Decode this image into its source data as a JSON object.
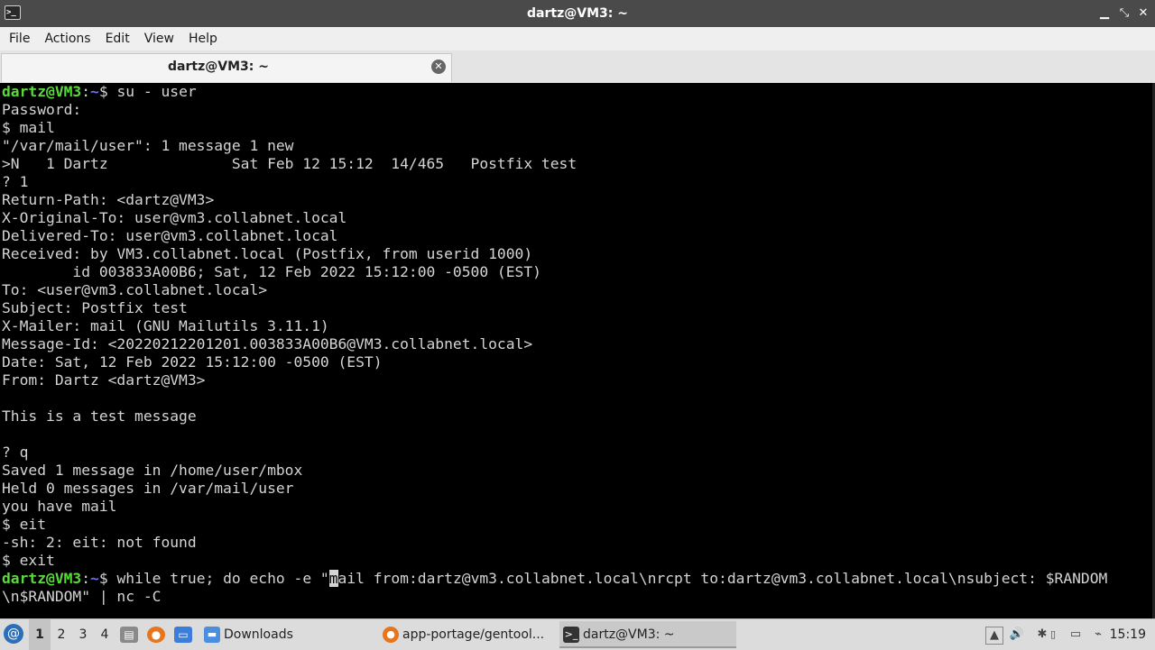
{
  "window": {
    "title": "dartz@VM3: ~",
    "controls": {
      "minimize": "▁",
      "maximize": "⤡",
      "close": "✕"
    }
  },
  "menu": {
    "items": [
      "File",
      "Actions",
      "Edit",
      "View",
      "Help"
    ]
  },
  "tab": {
    "label": "dartz@VM3: ~",
    "close_glyph": "✕"
  },
  "terminal": {
    "prompt": {
      "user": "dartz@VM3",
      "sep": ":",
      "path": "~",
      "symbol": "$ "
    },
    "commands": {
      "first": "su - user",
      "cmd_before_cursor": "while true; do echo -e \"",
      "cursor_char": "m",
      "cmd_after_cursor": "ail from:dartz@vm3.collabnet.local\\nrcpt to:dartz@vm3.collabnet.local\\nsubject: $RANDOM"
    },
    "lines": [
      "Password:",
      "$ mail",
      "\"/var/mail/user\": 1 message 1 new",
      ">N   1 Dartz              Sat Feb 12 15:12  14/465   Postfix test",
      "? 1",
      "Return-Path: <dartz@VM3>",
      "X-Original-To: user@vm3.collabnet.local",
      "Delivered-To: user@vm3.collabnet.local",
      "Received: by VM3.collabnet.local (Postfix, from userid 1000)",
      "        id 003833A00B6; Sat, 12 Feb 2022 15:12:00 -0500 (EST)",
      "To: <user@vm3.collabnet.local>",
      "Subject: Postfix test",
      "X-Mailer: mail (GNU Mailutils 3.11.1)",
      "Message-Id: <20220212201201.003833A00B6@VM3.collabnet.local>",
      "Date: Sat, 12 Feb 2022 15:12:00 -0500 (EST)",
      "From: Dartz <dartz@VM3>",
      "",
      "This is a test message",
      "",
      "? q",
      "Saved 1 message in /home/user/mbox",
      "Held 0 messages in /var/mail/user",
      "you have mail",
      "$ eit",
      "-sh: 2: eit: not found",
      "$ exit"
    ],
    "last_line": "\\n$RANDOM\" | nc -C"
  },
  "taskbar": {
    "start_icon": "debian-swirl-icon",
    "workspaces": [
      "1",
      "2",
      "3",
      "4"
    ],
    "active_workspace": "1",
    "tasks": [
      {
        "label": "Downloads",
        "icon": "folder-icon"
      },
      {
        "label": "app-portage/gentool...",
        "icon": "firefox-icon"
      },
      {
        "label": "dartz@VM3: ~",
        "icon": "terminal-icon"
      }
    ],
    "clock": "15:19"
  },
  "colors": {
    "prompt_user": "#5ad93a",
    "prompt_path": "#6f6ff0",
    "terminal_bg": "#000000",
    "titlebar_bg": "#4a4a4a"
  }
}
